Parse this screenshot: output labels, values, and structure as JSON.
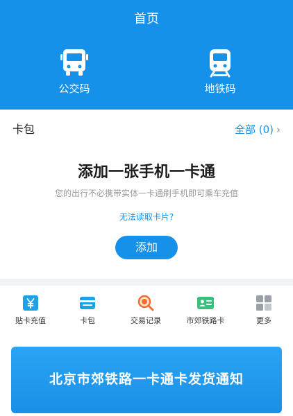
{
  "header": {
    "title": "首页",
    "qr_codes": [
      {
        "label": "公交码",
        "icon": "bus-icon"
      },
      {
        "label": "地铁码",
        "icon": "metro-icon"
      }
    ],
    "background_color": "#1591ea"
  },
  "card_bag": {
    "title": "卡包",
    "view_all_label": "全部 (0)",
    "add_title": "添加一张手机一卡通",
    "add_subtitle": "您的出行不必携带实体一卡通刷手机即可乘车充值",
    "cannot_read_link": "无法读取卡片?",
    "add_button_label": "添加"
  },
  "functions": [
    {
      "label": "贴卡充值",
      "icon": "yuan-card-icon"
    },
    {
      "label": "卡包",
      "icon": "wallet-icon"
    },
    {
      "label": "交易记录",
      "icon": "search-record-icon"
    },
    {
      "label": "市郊铁路卡",
      "icon": "id-card-icon"
    },
    {
      "label": "更多",
      "icon": "grid-icon"
    }
  ],
  "banner": {
    "text": "北京市郊铁路一卡通卡发货通知"
  }
}
